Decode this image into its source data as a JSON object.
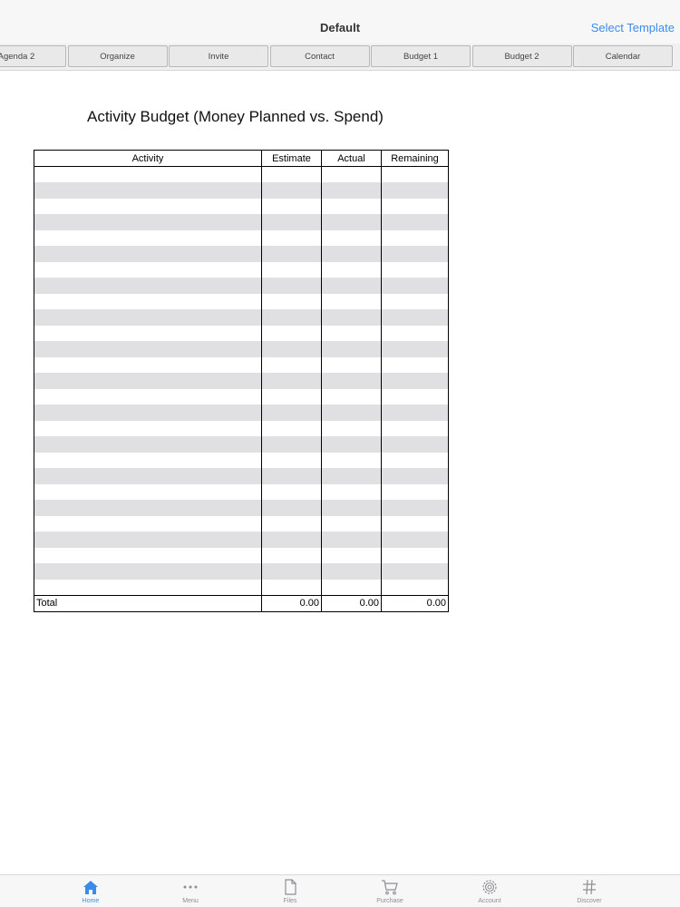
{
  "navbar": {
    "title": "Default",
    "action": "Select Template"
  },
  "tabs": [
    "Agenda 2",
    "Organize",
    "Invite",
    "Contact",
    "Budget 1",
    "Budget 2",
    "Calendar"
  ],
  "document": {
    "title": "Activity Budget (Money Planned vs. Spend)",
    "columns": [
      "Activity",
      "Estimate",
      "Actual",
      "Remaining"
    ],
    "row_count": 27,
    "total_row": {
      "label": "Total",
      "estimate": "0.00",
      "actual": "0.00",
      "remaining": "0.00"
    }
  },
  "tabbar": {
    "items": [
      {
        "label": "Home",
        "icon": "home-icon",
        "active": true
      },
      {
        "label": "Menu",
        "icon": "more-dots-icon",
        "active": false
      },
      {
        "label": "Files",
        "icon": "file-icon",
        "active": false
      },
      {
        "label": "Purchase",
        "icon": "cart-icon",
        "active": false
      },
      {
        "label": "Account",
        "icon": "gear-icon",
        "active": false
      },
      {
        "label": "Discover",
        "icon": "hashtag-icon",
        "active": false
      }
    ],
    "active_color": "#3b8bea",
    "inactive_color": "#8e8e93"
  }
}
